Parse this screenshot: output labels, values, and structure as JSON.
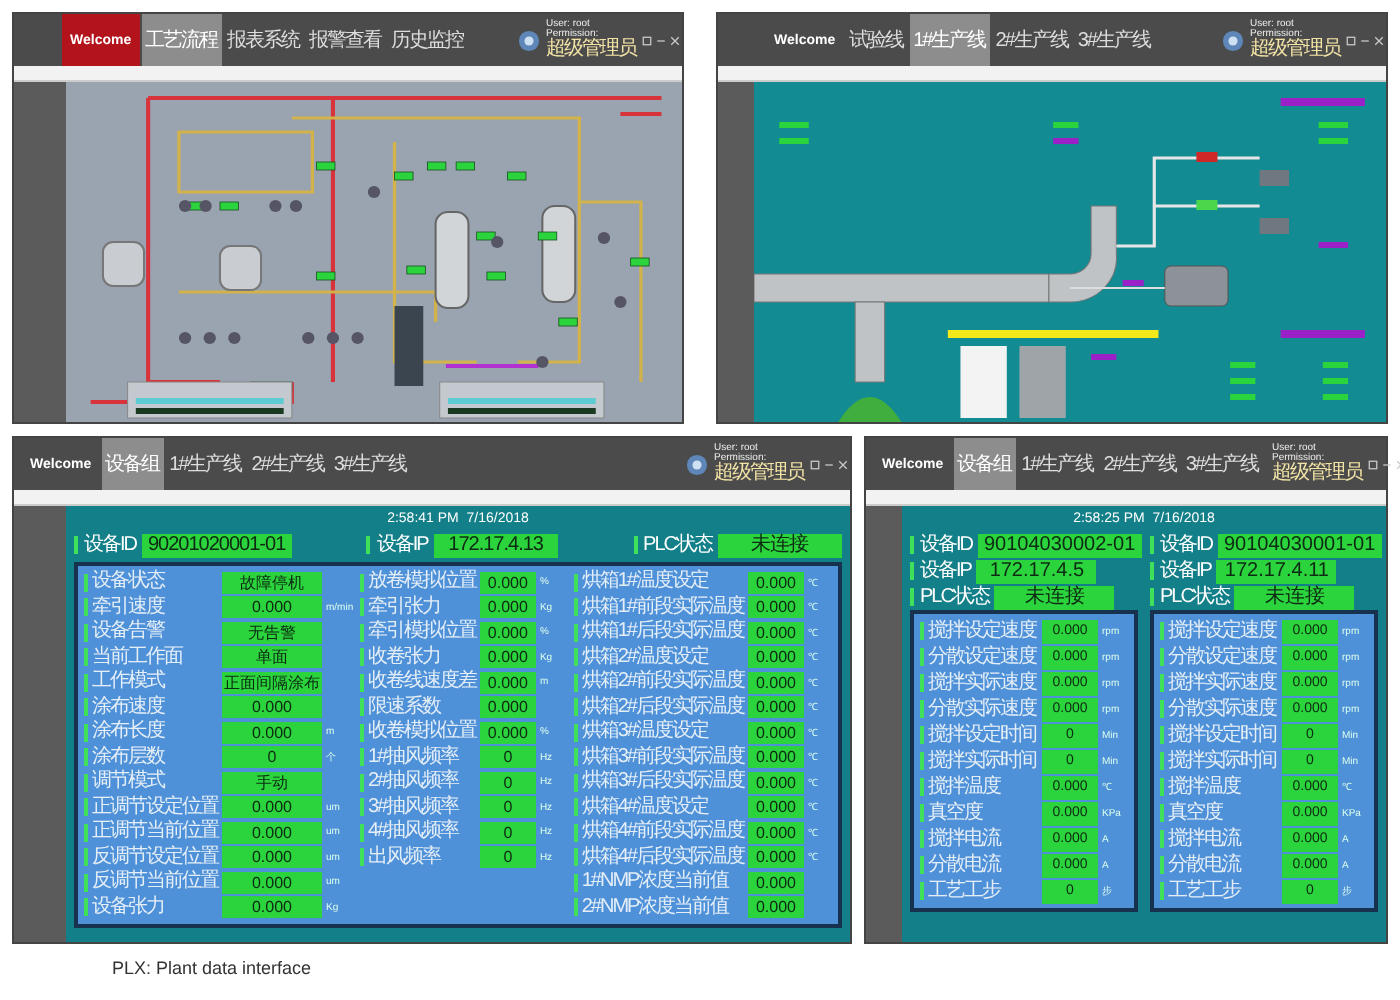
{
  "panels": [
    {
      "kind": "process",
      "header": {
        "welcome": {
          "label": "Welcome",
          "highlighted": true
        },
        "tabs": [
          {
            "label": "工艺流程",
            "selected": true
          },
          {
            "label": "报表系统",
            "selected": false
          },
          {
            "label": "报警查看",
            "selected": false
          },
          {
            "label": "历史监控",
            "selected": false
          }
        ],
        "user": "User: root",
        "permission_label": "Permission:",
        "permission": "超级管理员"
      }
    },
    {
      "kind": "pipeline",
      "header": {
        "welcome": {
          "label": "Welcome",
          "highlighted": false
        },
        "tabs": [
          {
            "label": "试验线",
            "selected": false
          },
          {
            "label": "1#生产线",
            "selected": true
          },
          {
            "label": "2#生产线",
            "selected": false
          },
          {
            "label": "3#生产线",
            "selected": false
          }
        ],
        "user": "User: root",
        "permission_label": "Permission:",
        "permission": "超级管理员"
      }
    },
    {
      "kind": "coater",
      "header": {
        "welcome": {
          "label": "Welcome",
          "highlighted": false
        },
        "tabs": [
          {
            "label": "设备组",
            "selected": true
          },
          {
            "label": "1#生产线",
            "selected": false
          },
          {
            "label": "2#生产线",
            "selected": false
          },
          {
            "label": "3#生产线",
            "selected": false
          }
        ],
        "user": "User: root",
        "permission_label": "Permission:",
        "permission": "超级管理员"
      },
      "time": "2:58:41 PM  7/16/2018",
      "info": [
        {
          "label": "设备ID",
          "value": "90201020001-01"
        },
        {
          "label": "设备IP",
          "value": "172.17.4.13"
        },
        {
          "label": "PLC状态",
          "value": "未连接"
        }
      ],
      "columns": [
        [
          {
            "label": "设备状态",
            "value": "故障停机"
          },
          {
            "label": "牵引速度",
            "value": "0.000",
            "unit": "m/min"
          },
          {
            "label": "设备告警",
            "value": "无告警"
          },
          {
            "label": "当前工作面",
            "value": "单面"
          },
          {
            "label": "工作模式",
            "value": "正面间隔涂布"
          },
          {
            "label": "涂布速度",
            "value": "0.000"
          },
          {
            "label": "涂布长度",
            "value": "0.000",
            "unit": "m"
          },
          {
            "label": "涂布层数",
            "value": "0",
            "unit": "个"
          },
          {
            "label": "调节模式",
            "value": "手动"
          },
          {
            "label": "正调节设定位置",
            "value": "0.000",
            "unit": "um"
          },
          {
            "label": "正调节当前位置",
            "value": "0.000",
            "unit": "um"
          },
          {
            "label": "反调节设定位置",
            "value": "0.000",
            "unit": "um"
          },
          {
            "label": "反调节当前位置",
            "value": "0.000",
            "unit": "um"
          },
          {
            "label": "设备张力",
            "value": "0.000",
            "unit": "Kg"
          }
        ],
        [
          {
            "label": "放卷模拟位置",
            "value": "0.000",
            "unit": "%"
          },
          {
            "label": "牵引张力",
            "value": "0.000",
            "unit": "Kg"
          },
          {
            "label": "牵引模拟位置",
            "value": "0.000",
            "unit": "%"
          },
          {
            "label": "收卷张力",
            "value": "0.000",
            "unit": "Kg"
          },
          {
            "label": "收卷线速度差",
            "value": "0.000",
            "unit": "m"
          },
          {
            "label": "限速系数",
            "value": "0.000"
          },
          {
            "label": "收卷模拟位置",
            "value": "0.000",
            "unit": "%"
          },
          {
            "label": "1#抽风频率",
            "value": "0",
            "unit": "Hz"
          },
          {
            "label": "2#抽风频率",
            "value": "0",
            "unit": "Hz"
          },
          {
            "label": "3#抽风频率",
            "value": "0",
            "unit": "Hz"
          },
          {
            "label": "4#抽风频率",
            "value": "0",
            "unit": "Hz"
          },
          {
            "label": "出风频率",
            "value": "0",
            "unit": "Hz"
          }
        ],
        [
          {
            "label": "烘箱1#温度设定",
            "value": "0.000",
            "unit": "℃"
          },
          {
            "label": "烘箱1#前段实际温度",
            "value": "0.000",
            "unit": "℃"
          },
          {
            "label": "烘箱1#后段实际温度",
            "value": "0.000",
            "unit": "℃"
          },
          {
            "label": "烘箱2#温度设定",
            "value": "0.000",
            "unit": "℃"
          },
          {
            "label": "烘箱2#前段实际温度",
            "value": "0.000",
            "unit": "℃"
          },
          {
            "label": "烘箱2#后段实际温度",
            "value": "0.000",
            "unit": "℃"
          },
          {
            "label": "烘箱3#温度设定",
            "value": "0.000",
            "unit": "℃"
          },
          {
            "label": "烘箱3#前段实际温度",
            "value": "0.000",
            "unit": "℃"
          },
          {
            "label": "烘箱3#后段实际温度",
            "value": "0.000",
            "unit": "℃"
          },
          {
            "label": "烘箱4#温度设定",
            "value": "0.000",
            "unit": "℃"
          },
          {
            "label": "烘箱4#前段实际温度",
            "value": "0.000",
            "unit": "℃"
          },
          {
            "label": "烘箱4#后段实际温度",
            "value": "0.000",
            "unit": "℃"
          },
          {
            "label": "1#NMP浓度当前值",
            "value": "0.000"
          },
          {
            "label": "2#NMP浓度当前值",
            "value": "0.000"
          }
        ]
      ]
    },
    {
      "kind": "mixer",
      "header": {
        "welcome": {
          "label": "Welcome",
          "highlighted": false
        },
        "tabs": [
          {
            "label": "设备组",
            "selected": true
          },
          {
            "label": "1#生产线",
            "selected": false
          },
          {
            "label": "2#生产线",
            "selected": false
          },
          {
            "label": "3#生产线",
            "selected": false
          }
        ],
        "user": "User: root",
        "permission_label": "Permission:",
        "permission": "超级管理员"
      },
      "time": "2:58:25 PM  7/16/2018",
      "units": [
        {
          "info": [
            {
              "label": "设备ID",
              "value": "90104030002-01"
            },
            {
              "label": "设备IP",
              "value": "172.17.4.5"
            },
            {
              "label": "PLC状态",
              "value": "未连接"
            }
          ],
          "rows": [
            {
              "label": "搅拌设定速度",
              "value": "0.000",
              "unit": "rpm"
            },
            {
              "label": "分散设定速度",
              "value": "0.000",
              "unit": "rpm"
            },
            {
              "label": "搅拌实际速度",
              "value": "0.000",
              "unit": "rpm"
            },
            {
              "label": "分散实际速度",
              "value": "0.000",
              "unit": "rpm"
            },
            {
              "label": "搅拌设定时间",
              "value": "0",
              "unit": "Min"
            },
            {
              "label": "搅拌实际时间",
              "value": "0",
              "unit": "Min"
            },
            {
              "label": "搅拌温度",
              "value": "0.000",
              "unit": "℃"
            },
            {
              "label": "真空度",
              "value": "0.000",
              "unit": "KPa"
            },
            {
              "label": "搅拌电流",
              "value": "0.000",
              "unit": "A"
            },
            {
              "label": "分散电流",
              "value": "0.000",
              "unit": "A"
            },
            {
              "label": "工艺工步",
              "value": "0",
              "unit": "步"
            }
          ]
        },
        {
          "info": [
            {
              "label": "设备ID",
              "value": "90104030001-01"
            },
            {
              "label": "设备IP",
              "value": "172.17.4.11"
            },
            {
              "label": "PLC状态",
              "value": "未连接"
            }
          ],
          "rows": [
            {
              "label": "搅拌设定速度",
              "value": "0.000",
              "unit": "rpm"
            },
            {
              "label": "分散设定速度",
              "value": "0.000",
              "unit": "rpm"
            },
            {
              "label": "搅拌实际速度",
              "value": "0.000",
              "unit": "rpm"
            },
            {
              "label": "分散实际速度",
              "value": "0.000",
              "unit": "rpm"
            },
            {
              "label": "搅拌设定时间",
              "value": "0",
              "unit": "Min"
            },
            {
              "label": "搅拌实际时间",
              "value": "0",
              "unit": "Min"
            },
            {
              "label": "搅拌温度",
              "value": "0.000",
              "unit": "℃"
            },
            {
              "label": "真空度",
              "value": "0.000",
              "unit": "KPa"
            },
            {
              "label": "搅拌电流",
              "value": "0.000",
              "unit": "A"
            },
            {
              "label": "分散电流",
              "value": "0.000",
              "unit": "A"
            },
            {
              "label": "工艺工步",
              "value": "0",
              "unit": "步"
            }
          ]
        }
      ]
    }
  ],
  "caption": "PLX: Plant data interface"
}
